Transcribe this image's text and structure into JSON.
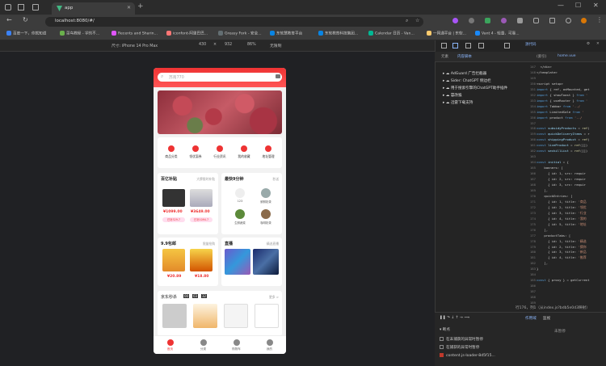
{
  "browser": {
    "tab_title": "app",
    "url": "localhost:8080/#/",
    "bookmarks": [
      "百度一下，你就知道",
      "菜鸟教程 - 学的不...",
      "Recents and Sharin...",
      "iconfont-阿里巴巴...",
      "Greasy Fork - 安全...",
      "东软慧教育平台",
      "东软教育科技集团...",
      "Calendar 日历 - Van...",
      "一网通平台 | 东软...",
      "Vant 4 - 轻量、可靠..."
    ]
  },
  "device_toolbar": {
    "device": "尺寸: iPhone 14 Pro Max",
    "width": "430",
    "height": "932",
    "zoom": "86%",
    "throttle": "无限制"
  },
  "app": {
    "search_placeholder": "苏南770",
    "quick_entries": [
      "商品分类",
      "领优惠券",
      "行业资讯",
      "我的收藏",
      "地址管理"
    ],
    "subsidy": {
      "title": "百亿补贴",
      "more": "大牌限时补贴",
      "price1": "¥1099.00",
      "pill1": "已补329.7",
      "price2": "¥3649.00",
      "pill2": "已补1094.7"
    },
    "seckill": {
      "title": "最快9分钟",
      "more": "秒送",
      "items": [
        "123",
        "鲜鲜奶茶",
        "生鲜蔬菜",
        "咖啡奶茶"
      ]
    },
    "ninenine": {
      "title": "9.9包邮",
      "more": "限量抢购",
      "price1": "¥20.89",
      "price2": "¥18.80"
    },
    "live": {
      "title": "直播",
      "more": "精选直播"
    },
    "jd": {
      "title": "京东秒杀",
      "h": "00",
      "m": "03",
      "s": "32",
      "more": "更多 >"
    },
    "tabs": [
      "首页",
      "分类",
      "购物车",
      "我的"
    ]
  },
  "devtools": {
    "tabs": [
      "元素",
      "内容脚本"
    ],
    "source_tab": "源代码",
    "file_tabs": [
      "(索引)",
      "home.vue"
    ],
    "tree": [
      "AdGuard 广告拦截器",
      "Sider: ChatGPT 侧边栏",
      "用于搜索引擎的ChatGPT助手插件",
      "篡改猴",
      "迅雷下载支持"
    ],
    "status": "行176，列1（从index.js?bdb5e0d3映射）",
    "scope_tabs": [
      "作用域",
      "监视"
    ],
    "not_paused": "未暂停",
    "breakpoints_header": "断点",
    "bp1": "在未捕获的异常时暂停",
    "bp2": "在捕获的异常时暂停",
    "bp3": "content.js-loader-8d5f15..."
  }
}
